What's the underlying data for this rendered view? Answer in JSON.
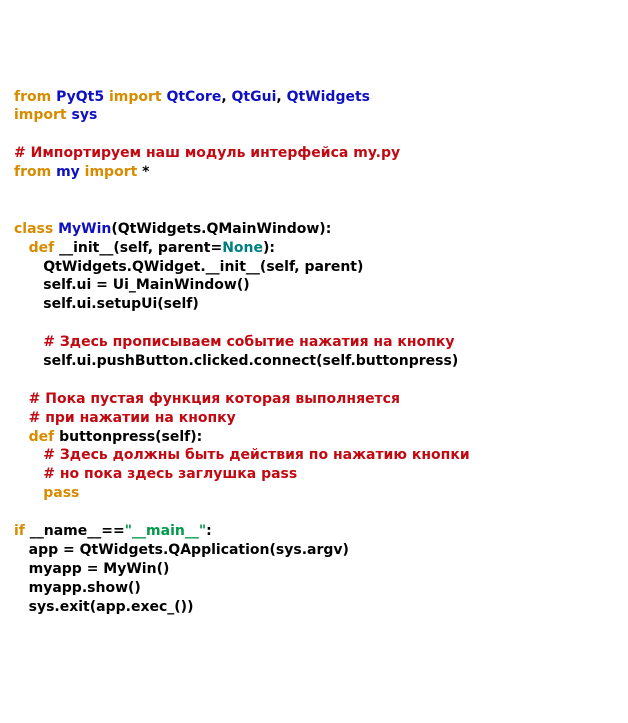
{
  "code": {
    "l1": {
      "a": "from",
      "b": "PyQt5",
      "c": "import",
      "d": "QtCore",
      "e": ",",
      "f": "QtGui",
      "g": ",",
      "h": "QtWidgets"
    },
    "l2": {
      "a": "import",
      "b": "sys"
    },
    "l3": "# Импортируем наш модуль интерфейса my.py",
    "l4": {
      "a": "from",
      "b": "my",
      "c": "import",
      "d": "*"
    },
    "l5": {
      "a": "class",
      "b": "MyWin",
      "c": "(QtWidgets",
      "d": ".QMainWindow):"
    },
    "l6": {
      "a": "def",
      "b": "__init__",
      "c": "(self, parent=",
      "d": "None",
      "e": "):"
    },
    "l7": "QtWidgets.QWidget.__init__(self, parent)",
    "l8": "self.ui = Ui_MainWindow()",
    "l9": "self.ui.setupUi(self)",
    "l10": "# Здесь прописываем событие нажатия на кнопку",
    "l11": "self.ui.pushButton.clicked.connect(self.buttonpress)",
    "l12": "# Пока пустая функция которая выполняется",
    "l13": "# при нажатии на кнопку",
    "l14": {
      "a": "def",
      "b": "buttonpress",
      "c": "(self):"
    },
    "l15": "# Здесь должны быть действия по нажатию кнопки",
    "l16": "# но пока здесь заглушка pass",
    "l17": "pass",
    "l18": {
      "a": "if",
      "b": "__name__",
      "c": "==",
      "d": "\"__main__\"",
      "e": ":"
    },
    "l19": "app = QtWidgets.QApplication(sys.argv)",
    "l20": "myapp = MyWin()",
    "l21": "myapp.show()",
    "l22": "sys.exit(app.exec_())"
  }
}
